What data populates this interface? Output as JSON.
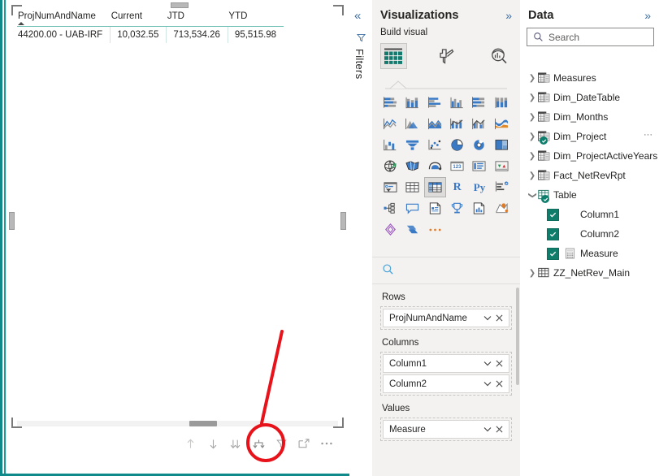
{
  "canvas": {
    "visual": {
      "type": "matrix-table",
      "headers": [
        "ProjNumAndName",
        "Current",
        "JTD",
        "YTD"
      ],
      "sorted_column": "ProjNumAndName",
      "sort_direction": "ascending",
      "rows": [
        [
          "44200.00 - UAB-IRF",
          "10,032.55",
          "713,534.26",
          "95,515.98"
        ]
      ]
    },
    "toolbar": {
      "items": [
        {
          "name": "drill-up-icon",
          "label": "Drill up",
          "state": "disabled"
        },
        {
          "name": "drill-down-icon",
          "label": "Drill down",
          "state": "enabled"
        },
        {
          "name": "expand-next-level-icon",
          "label": "Go to the next level in the hierarchy",
          "state": "enabled"
        },
        {
          "name": "expand-all-down-icon",
          "label": "Expand all down one level in the hierarchy",
          "state": "highlighted"
        },
        {
          "name": "filter-funnel-icon",
          "label": "Filters",
          "state": "enabled"
        },
        {
          "name": "focus-mode-icon",
          "label": "Focus mode",
          "state": "enabled"
        },
        {
          "name": "more-options-icon",
          "label": "More options",
          "state": "enabled"
        }
      ]
    },
    "annotation": {
      "shape": "circle-with-pointer-line",
      "color": "#e8121a",
      "targets": "expand-all-down-icon"
    }
  },
  "filters_rail": {
    "collapse_label": "«",
    "title": "Filters"
  },
  "visualizations": {
    "title": "Visualizations",
    "expand_chevron": "»",
    "subtitle": "Build visual",
    "tabs": [
      {
        "name": "build-visual-tab",
        "label": "Build visual",
        "selected": true
      },
      {
        "name": "format-visual-tab",
        "label": "Format visual",
        "selected": false
      },
      {
        "name": "analytics-tab",
        "label": "Analytics",
        "selected": false
      }
    ],
    "gallery": [
      "stacked-bar-chart",
      "stacked-column-chart",
      "clustered-bar-chart",
      "clustered-column-chart",
      "100-stacked-bar-chart",
      "100-stacked-column-chart",
      "line-chart",
      "area-chart",
      "stacked-area-chart",
      "line-and-stacked-column-chart",
      "line-and-clustered-column-chart",
      "ribbon-chart",
      "waterfall-chart",
      "funnel-chart",
      "scatter-chart",
      "pie-chart",
      "donut-chart",
      "treemap",
      "map",
      "filled-map",
      "azure-map",
      "card",
      "multi-row-card",
      "kpi",
      "slicer",
      "table",
      "matrix",
      "r-script-visual",
      "python-visual",
      "key-influencers",
      "decomposition-tree",
      "q-and-a",
      "narrative",
      "metrics",
      "paginated-report",
      "power-apps",
      "power-automate",
      "arcgis-maps",
      "get-more-visuals"
    ],
    "selected_gallery_item": "matrix",
    "search_icon": "search-icon",
    "wells": [
      {
        "name": "Rows",
        "fields": [
          "ProjNumAndName"
        ]
      },
      {
        "name": "Columns",
        "fields": [
          "Column1",
          "Column2"
        ]
      },
      {
        "name": "Values",
        "fields": [
          "Measure"
        ]
      }
    ],
    "chip_chevron": "⌄",
    "chip_remove": "×"
  },
  "data_panel": {
    "title": "Data",
    "expand_chevron": "»",
    "search_placeholder": "Search",
    "tree": [
      {
        "label": "Measures",
        "indent": 0,
        "expandable": true,
        "expanded": false,
        "icon": "table-icon",
        "badge": false,
        "checked": null
      },
      {
        "label": "Dim_DateTable",
        "indent": 0,
        "expandable": true,
        "expanded": false,
        "icon": "table-icon",
        "badge": false,
        "checked": null
      },
      {
        "label": "Dim_Months",
        "indent": 0,
        "expandable": true,
        "expanded": false,
        "icon": "table-icon",
        "badge": false,
        "checked": null
      },
      {
        "label": "Dim_Project",
        "indent": 0,
        "expandable": true,
        "expanded": false,
        "icon": "table-icon",
        "badge": true,
        "checked": null,
        "overflow": "···"
      },
      {
        "label": "Dim_ProjectActiveYears",
        "indent": 0,
        "expandable": true,
        "expanded": false,
        "icon": "table-icon",
        "badge": false,
        "checked": null
      },
      {
        "label": "Fact_NetRevRpt",
        "indent": 0,
        "expandable": true,
        "expanded": false,
        "icon": "table-icon",
        "badge": false,
        "checked": null
      },
      {
        "label": "Table",
        "indent": 0,
        "expandable": true,
        "expanded": true,
        "icon": "table-grid-icon",
        "badge": true,
        "checked": null
      },
      {
        "label": "Column1",
        "indent": 1,
        "expandable": false,
        "expanded": false,
        "icon": null,
        "badge": false,
        "checked": true
      },
      {
        "label": "Column2",
        "indent": 1,
        "expandable": false,
        "expanded": false,
        "icon": null,
        "badge": false,
        "checked": true
      },
      {
        "label": "Measure",
        "indent": 1,
        "expandable": false,
        "expanded": false,
        "icon": "calculator-icon",
        "badge": false,
        "checked": true
      },
      {
        "label": "ZZ_NetRev_Main",
        "indent": 0,
        "expandable": true,
        "expanded": false,
        "icon": "table-grid-icon",
        "badge": false,
        "checked": null
      }
    ]
  },
  "colors": {
    "accent_teal": "#0f8a8a",
    "panel_bg": "#f3f2f1",
    "annotation_red": "#e8121a",
    "check_green": "#107c6a",
    "link_blue": "#3b6ea5"
  }
}
